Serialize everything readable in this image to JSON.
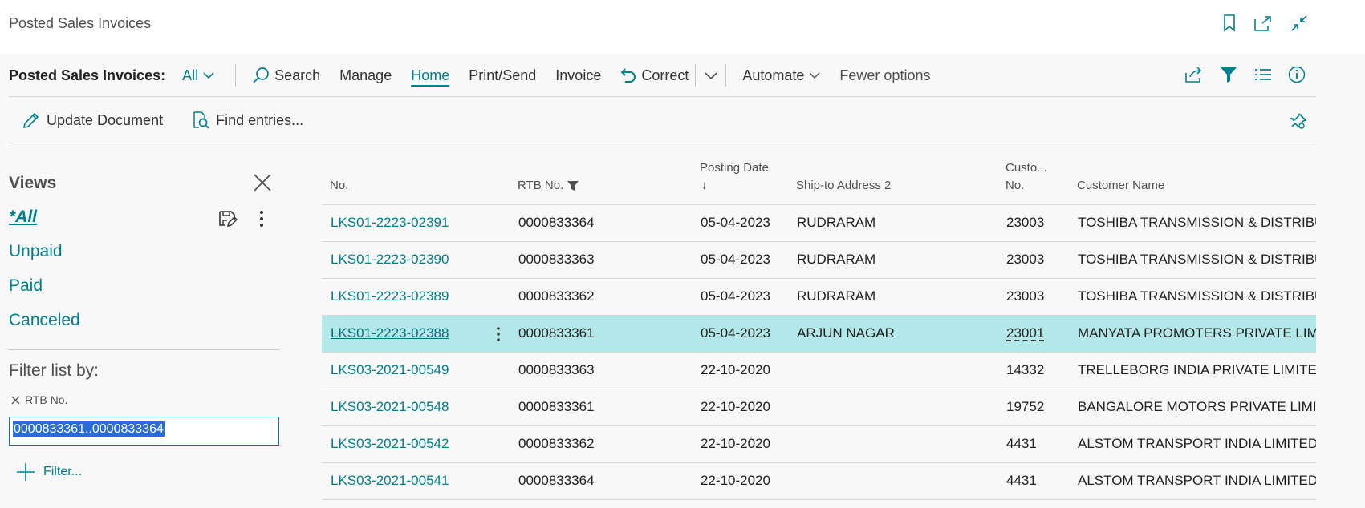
{
  "window": {
    "title": "Posted Sales Invoices"
  },
  "actionbar": {
    "page_label": "Posted Sales Invoices:",
    "view_label": "All",
    "items": [
      {
        "label": "Search"
      },
      {
        "label": "Manage"
      },
      {
        "label": "Home"
      },
      {
        "label": "Print/Send"
      },
      {
        "label": "Invoice"
      },
      {
        "label": "Correct"
      },
      {
        "label": "Automate"
      },
      {
        "label": "Fewer options"
      }
    ]
  },
  "subbar": {
    "update_document": "Update Document",
    "find_entries": "Find entries..."
  },
  "views": {
    "title": "Views",
    "items": [
      "*All",
      "Unpaid",
      "Paid",
      "Canceled"
    ],
    "filter_title": "Filter list by:",
    "filter_field": "RTB No.",
    "filter_value": "0000833361..0000833364",
    "add_filter": "Filter..."
  },
  "list": {
    "columns": {
      "no": "No.",
      "rtb_no": "RTB No.",
      "posting_date_l1": "Posting Date",
      "posting_date_l2": "↓",
      "ship_to": "Ship-to Address 2",
      "cust_no_l1": "Custo...",
      "cust_no_l2": "No.",
      "customer_name": "Customer Name"
    },
    "rows": [
      {
        "no": "LKS01-2223-02391",
        "rtb": "0000833364",
        "date": "05-04-2023",
        "ship": "RUDRARAM",
        "cust": "23003",
        "name": "TOSHIBA TRANSMISSION & DISTRIBUTION"
      },
      {
        "no": "LKS01-2223-02390",
        "rtb": "0000833363",
        "date": "05-04-2023",
        "ship": "RUDRARAM",
        "cust": "23003",
        "name": "TOSHIBA TRANSMISSION & DISTRIBUTION"
      },
      {
        "no": "LKS01-2223-02389",
        "rtb": "0000833362",
        "date": "05-04-2023",
        "ship": "RUDRARAM",
        "cust": "23003",
        "name": "TOSHIBA TRANSMISSION & DISTRIBUTION"
      },
      {
        "no": "LKS01-2223-02388",
        "rtb": "0000833361",
        "date": "05-04-2023",
        "ship": "ARJUN NAGAR",
        "cust": "23001",
        "name": "MANYATA PROMOTERS PRIVATE LIMITED"
      },
      {
        "no": "LKS03-2021-00549",
        "rtb": "0000833363",
        "date": "22-10-2020",
        "ship": "",
        "cust": "14332",
        "name": "TRELLEBORG INDIA PRIVATE LIMITED"
      },
      {
        "no": "LKS03-2021-00548",
        "rtb": "0000833361",
        "date": "22-10-2020",
        "ship": "",
        "cust": "19752",
        "name": "BANGALORE MOTORS PRIVATE LIMITED"
      },
      {
        "no": "LKS03-2021-00542",
        "rtb": "0000833362",
        "date": "22-10-2020",
        "ship": "",
        "cust": "4431",
        "name": "ALSTOM TRANSPORT INDIA LIMITED"
      },
      {
        "no": "LKS03-2021-00541",
        "rtb": "0000833364",
        "date": "22-10-2020",
        "ship": "",
        "cust": "4431",
        "name": "ALSTOM TRANSPORT INDIA LIMITED"
      }
    ],
    "selected_row": 3
  },
  "colors": {
    "accent": "#00808c",
    "selected_row": "#b3e8ea",
    "background": "#f8f8f8"
  }
}
